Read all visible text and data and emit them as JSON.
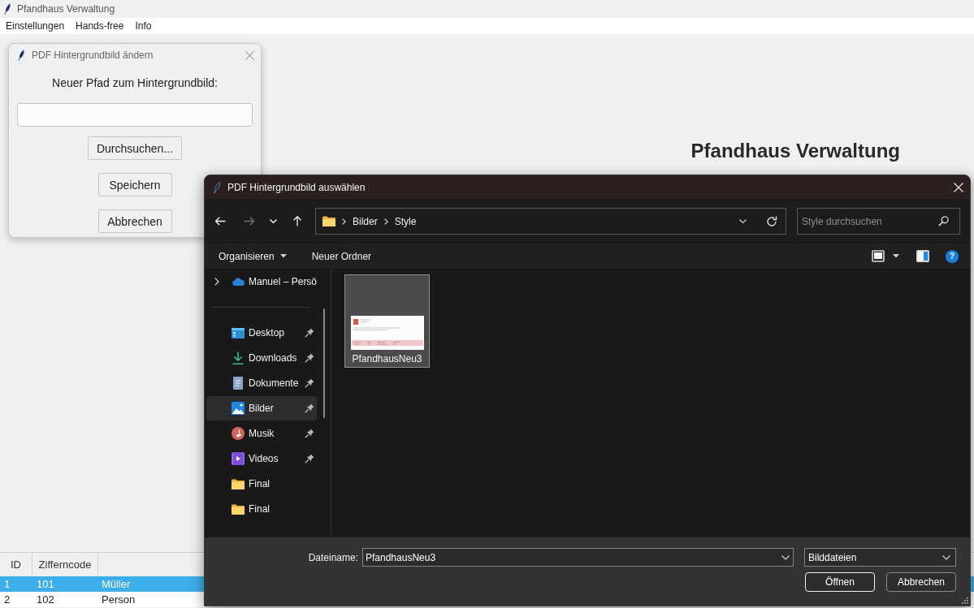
{
  "app_window": {
    "title": "Pfandhaus Verwaltung"
  },
  "menu": [
    {
      "label": "Einstellungen"
    },
    {
      "label": "Hands-free"
    },
    {
      "label": "Info"
    }
  ],
  "heading": "Pfandhaus Verwaltung",
  "table": {
    "columns": [
      "ID",
      "Zifferncode"
    ],
    "rows": [
      {
        "cells": [
          "1",
          "101",
          "Müller"
        ],
        "selected": true
      },
      {
        "cells": [
          "2",
          "102",
          "Person"
        ],
        "selected": false
      }
    ]
  },
  "settings_dialog": {
    "title": "PDF Hintergrundbild ändern",
    "prompt": "Neuer Pfad zum Hintergrundbild:",
    "buttons": [
      "Durchsuchen...",
      "Speichern",
      "Abbrechen"
    ]
  },
  "file_dialog": {
    "title": "PDF Hintergrundbild auswählen",
    "nav_buttons": [
      {
        "kind": "back",
        "disabled": false
      },
      {
        "kind": "forward",
        "disabled": true
      },
      {
        "kind": "recent",
        "disabled": false
      },
      {
        "kind": "up",
        "disabled": false
      }
    ],
    "breadcrumb": [
      "Bilder",
      "Style"
    ],
    "search": {
      "placeholder": "Style durchsuchen"
    },
    "commands": [
      {
        "label": "Organisieren",
        "dropdown": true
      },
      {
        "label": "Neuer Ordner",
        "dropdown": false
      }
    ],
    "help_button": "?",
    "sidebar": {
      "cloud": {
        "label": "Manuel – Persö",
        "expanded": false
      },
      "items": [
        {
          "label": "Desktop",
          "kind": "desktop",
          "pinned": true,
          "selected": false
        },
        {
          "label": "Downloads",
          "kind": "downloads",
          "pinned": true,
          "selected": false
        },
        {
          "label": "Dokumente",
          "kind": "documents",
          "pinned": true,
          "selected": false
        },
        {
          "label": "Bilder",
          "kind": "pictures",
          "pinned": true,
          "selected": true
        },
        {
          "label": "Musik",
          "kind": "music",
          "pinned": true,
          "selected": false
        },
        {
          "label": "Videos",
          "kind": "videos",
          "pinned": true,
          "selected": false
        },
        {
          "label": "Final",
          "kind": "folder",
          "pinned": false,
          "selected": false
        },
        {
          "label": "Final",
          "kind": "folder",
          "pinned": false,
          "selected": false
        }
      ]
    },
    "files": [
      {
        "name": "PfandhausNeu3",
        "selected": true
      }
    ],
    "file_name": {
      "label": "Dateiname:",
      "value": "PfandhausNeu3"
    },
    "file_type": "Bilddateien",
    "buttons": [
      {
        "label": "Öffnen",
        "default": true
      },
      {
        "label": "Abbrechen",
        "default": false
      }
    ]
  }
}
